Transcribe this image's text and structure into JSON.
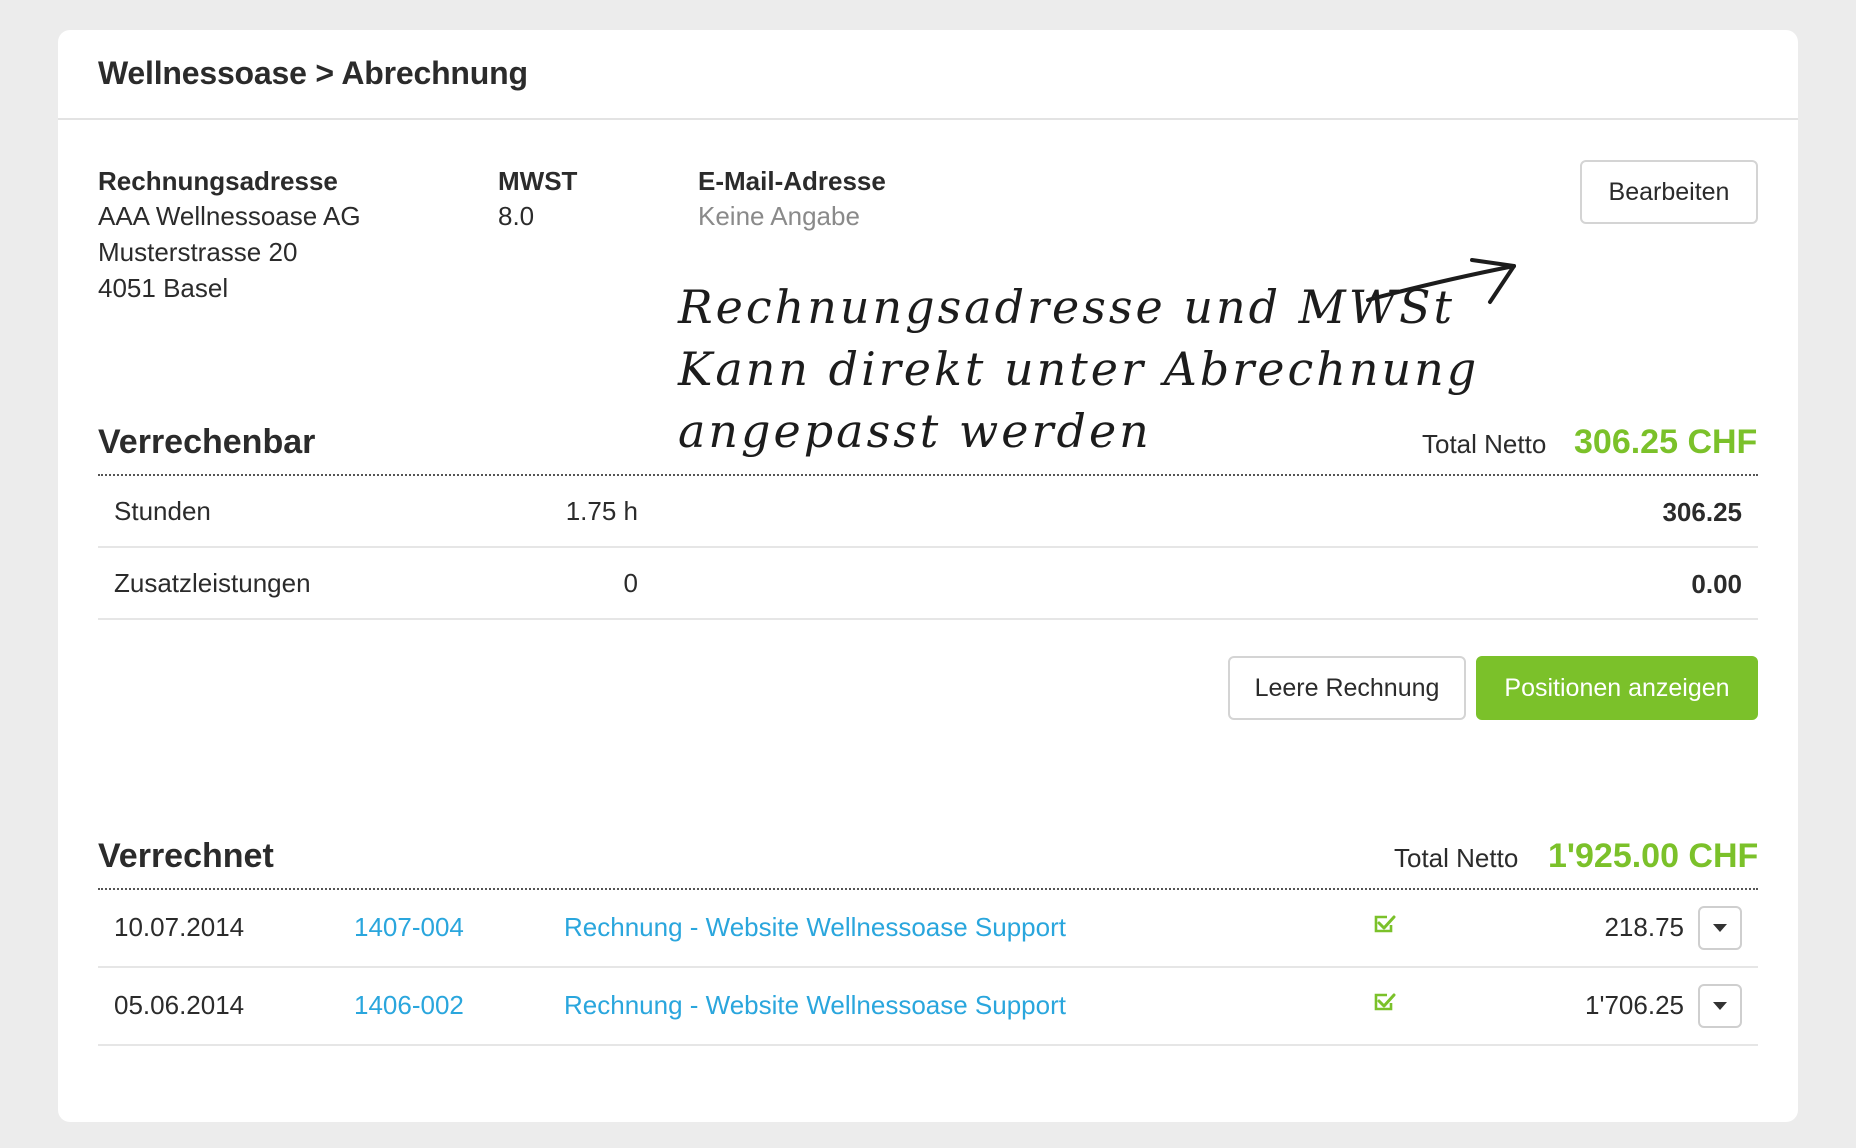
{
  "header": {
    "breadcrumb": "Wellnessoase > Abrechnung"
  },
  "billing": {
    "address_label": "Rechnungsadresse",
    "address_lines": [
      "AAA Wellnessoase AG",
      "Musterstrasse 20",
      "4051 Basel"
    ],
    "vat_label": "MWST",
    "vat_value": "8.0",
    "email_label": "E-Mail-Adresse",
    "email_value": "Keine Angabe",
    "edit_button": "Bearbeiten"
  },
  "annotation": {
    "lines": [
      "Rechnungsadresse und MWSt",
      "Kann direkt unter Abrechnung",
      "angepasst werden"
    ]
  },
  "billable": {
    "title": "Verrechenbar",
    "total_label": "Total Netto",
    "total_value": "306.25 CHF",
    "rows": [
      {
        "label": "Stunden",
        "qty": "1.75 h",
        "amount": "306.25"
      },
      {
        "label": "Zusatzleistungen",
        "qty": "0",
        "amount": "0.00"
      }
    ],
    "empty_invoice_button": "Leere Rechnung",
    "show_positions_button": "Positionen anzeigen"
  },
  "billed": {
    "title": "Verrechnet",
    "total_label": "Total Netto",
    "total_value": "1'925.00 CHF",
    "rows": [
      {
        "date": "10.07.2014",
        "number": "1407-004",
        "title": "Rechnung - Website Wellnessoase Support",
        "amount": "218.75"
      },
      {
        "date": "05.06.2014",
        "number": "1406-002",
        "title": "Rechnung - Website Wellnessoase Support",
        "amount": "1'706.25"
      }
    ]
  },
  "colors": {
    "accent": "#7bc12a",
    "link": "#2aa6dd"
  },
  "icons": {
    "paid": "check-square-icon",
    "row_menu": "caret-down-icon",
    "annotation_arrow": "arrow-icon"
  }
}
